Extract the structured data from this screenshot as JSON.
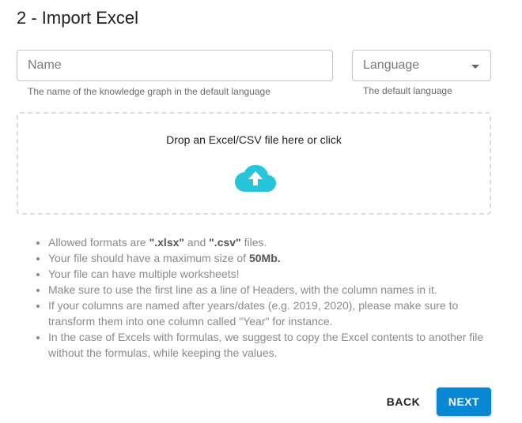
{
  "page": {
    "title": "2 - Import Excel"
  },
  "form": {
    "name_placeholder": "Name",
    "name_value": "",
    "name_helper": "The name of the knowledge graph in the default language",
    "language_placeholder": "Language",
    "language_helper": "The default language"
  },
  "dropzone": {
    "text": "Drop an Excel/CSV file here or click",
    "icon": "cloud-upload-icon",
    "icon_color": "#26c6da"
  },
  "rules": [
    {
      "pre": "Allowed formats are ",
      "b1": "\".xlsx\"",
      "mid": " and ",
      "b2": "\".csv\"",
      "post": " files."
    },
    {
      "pre": "Your file should have a maximum size of ",
      "b1": "50Mb.",
      "mid": "",
      "b2": "",
      "post": ""
    },
    {
      "pre": "Your file can have multiple worksheets!",
      "b1": "",
      "mid": "",
      "b2": "",
      "post": ""
    },
    {
      "pre": "Make sure to use the first line as a line of Headers, with the column names in it.",
      "b1": "",
      "mid": "",
      "b2": "",
      "post": ""
    },
    {
      "pre": "If your columns are named after years/dates (e.g. 2019, 2020), please make sure to transform them into one column called \"Year\" for instance.",
      "b1": "",
      "mid": "",
      "b2": "",
      "post": ""
    },
    {
      "pre": "In the case of Excels with formulas, we suggest to copy the Excel contents to another file without the formulas, while keeping the values.",
      "b1": "",
      "mid": "",
      "b2": "",
      "post": ""
    }
  ],
  "actions": {
    "back_label": "BACK",
    "next_label": "NEXT",
    "primary_color": "#0a87d2"
  }
}
